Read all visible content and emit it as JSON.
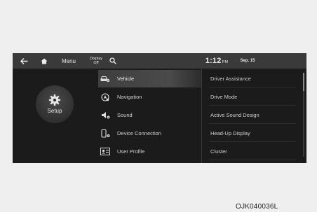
{
  "topbar": {
    "back_icon": "back-arrow-icon",
    "home_icon": "home-icon",
    "menu_label": "Menu",
    "display_off_line1": "Display",
    "display_off_line2": "Off",
    "search_icon": "search-icon",
    "time": "1:12",
    "time_suffix": "PM",
    "date": "Sep. 15"
  },
  "setup": {
    "label": "Setup",
    "icon": "gear-icon"
  },
  "menu": {
    "items": [
      {
        "label": "Vehicle",
        "icon": "car-gear-icon",
        "selected": true
      },
      {
        "label": "Navigation",
        "icon": "navigation-icon",
        "selected": false
      },
      {
        "label": "Sound",
        "icon": "speaker-icon",
        "selected": false
      },
      {
        "label": "Device Connection",
        "icon": "phone-link-icon",
        "selected": false
      },
      {
        "label": "User Profile",
        "icon": "profile-card-icon",
        "selected": false
      }
    ]
  },
  "submenu": {
    "items": [
      {
        "label": "Driver Assistance"
      },
      {
        "label": "Drive Mode"
      },
      {
        "label": "Active Sound Design"
      },
      {
        "label": "Head-Up Display"
      },
      {
        "label": "Cluster"
      }
    ]
  },
  "caption": "OJK040036L",
  "colors": {
    "background": "#efefef",
    "screen": "#1b1b1b",
    "topbar": "#3a3a3a",
    "selected": "#4a4a4a",
    "text": "#cfcfcf"
  }
}
